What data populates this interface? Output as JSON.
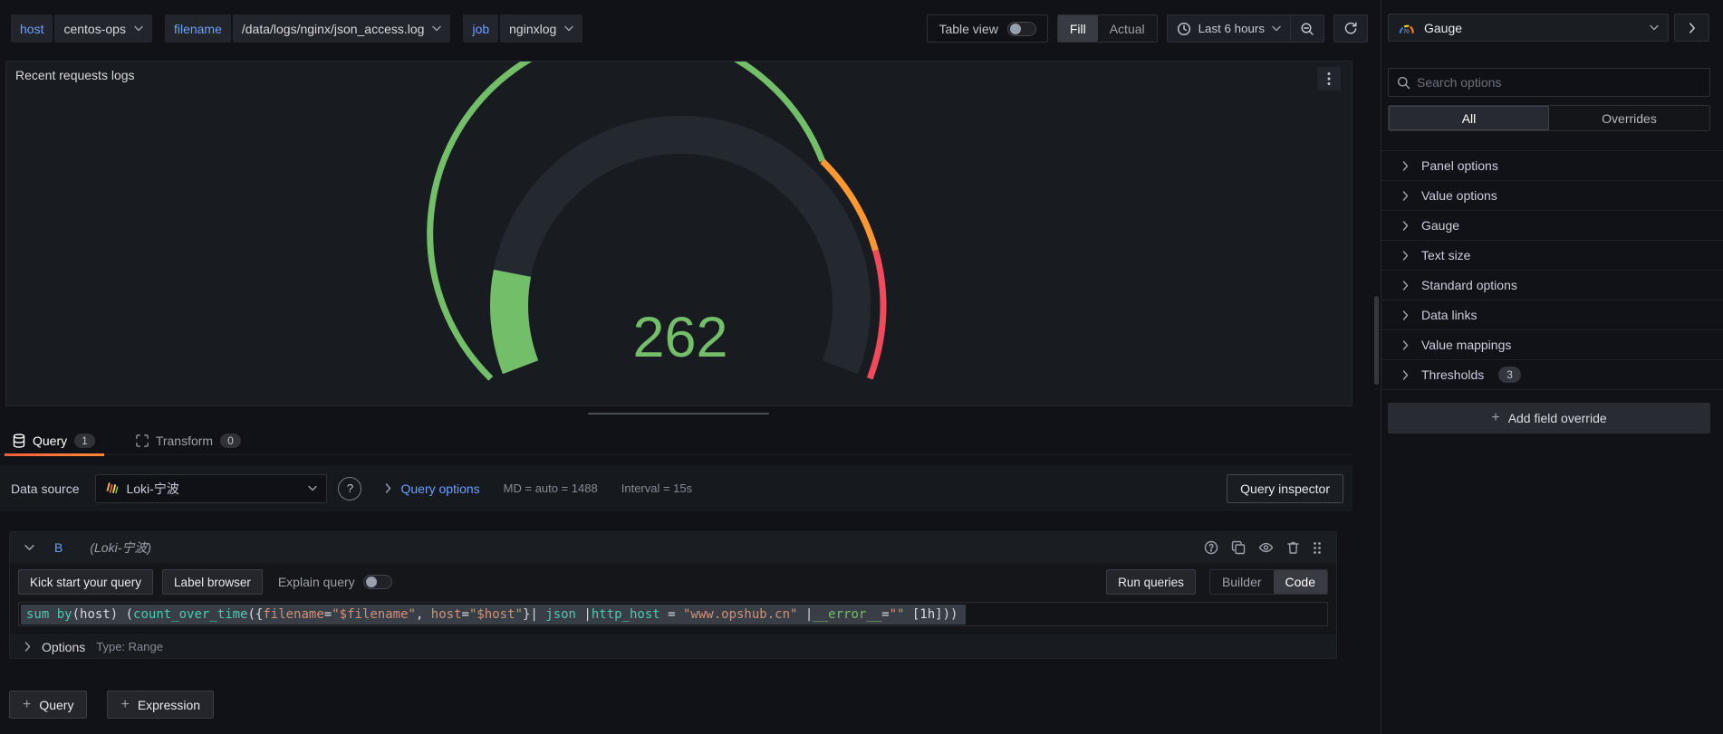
{
  "topbar": {
    "variables": [
      {
        "label": "host",
        "value": "centos-ops"
      },
      {
        "label": "filename",
        "value": "/data/logs/nginx/json_access.log"
      },
      {
        "label": "job",
        "value": "nginxlog"
      }
    ],
    "table_view_label": "Table view",
    "display_mode": {
      "fill": "Fill",
      "actual": "Actual",
      "active": "Fill"
    },
    "time_range": "Last 6 hours"
  },
  "panel": {
    "title": "Recent requests logs",
    "gauge": {
      "value": "262",
      "value_color": "#73BF69",
      "fill_percent": 14,
      "threshold_segments": [
        {
          "color": "#73BF69",
          "end_percent": 70
        },
        {
          "color": "#FF9830",
          "end_percent": 83
        },
        {
          "color": "#F2495C",
          "end_percent": 100
        }
      ]
    }
  },
  "editor": {
    "tabs": [
      {
        "label": "Query",
        "badge": "1"
      },
      {
        "label": "Transform",
        "badge": "0"
      }
    ],
    "datasource_row": {
      "label": "Data source",
      "selected": "Loki-宁波",
      "query_options": "Query options",
      "max_data_points": "MD = auto = 1488",
      "interval": "Interval = 15s",
      "inspector": "Query inspector"
    },
    "query": {
      "ref_id": "B",
      "datasource_hint": "(Loki-宁波)",
      "kick_start": "Kick start your query",
      "label_browser": "Label browser",
      "explain": "Explain query",
      "run": "Run queries",
      "builder": "Builder",
      "code": "Code",
      "tokens": [
        {
          "t": "sum"
        },
        {
          "t": " "
        },
        {
          "t": "by"
        },
        {
          "t": "("
        },
        {
          "t": "host"
        },
        {
          "t": ") ("
        },
        {
          "t": "count_over_time"
        },
        {
          "t": "({"
        },
        {
          "t": "filename"
        },
        {
          "t": "="
        },
        {
          "t": "\"$filename\""
        },
        {
          "t": ", "
        },
        {
          "t": "host"
        },
        {
          "t": "="
        },
        {
          "t": "\"$host\""
        },
        {
          "t": "}| "
        },
        {
          "t": "json"
        },
        {
          "t": " |"
        },
        {
          "t": "http_host"
        },
        {
          "t": " = "
        },
        {
          "t": "\"www.opshub.cn\""
        },
        {
          "t": " |"
        },
        {
          "t": "__error__"
        },
        {
          "t": "="
        },
        {
          "t": "\"\""
        },
        {
          "t": " [1h]))"
        }
      ],
      "options_label": "Options",
      "options_summary": "Type: Range"
    },
    "add_query": "Query",
    "add_expression": "Expression"
  },
  "sidebar": {
    "visualization": "Gauge",
    "search_placeholder": "Search options",
    "tab_all": "All",
    "tab_overrides": "Overrides",
    "options": [
      {
        "label": "Panel options"
      },
      {
        "label": "Value options"
      },
      {
        "label": "Gauge"
      },
      {
        "label": "Text size"
      },
      {
        "label": "Standard options"
      },
      {
        "label": "Data links"
      },
      {
        "label": "Value mappings"
      },
      {
        "label": "Thresholds",
        "badge": "3"
      }
    ],
    "add_field_override": "Add field override"
  },
  "icons": {
    "plus": "+",
    "help": "?",
    "viz_gauge_label": "70"
  },
  "colors": {
    "accent_blue": "#6E9FFF",
    "gauge_green": "#73BF69",
    "threshold_orange": "#FF9830",
    "threshold_red": "#F2495C",
    "tab_underline_gradient": [
      "#F55F3E",
      "#FF8833"
    ],
    "syntax_teal": "#4EC9B0",
    "syntax_salmon": "#CE9178",
    "syntax_green": "#73BF69"
  }
}
